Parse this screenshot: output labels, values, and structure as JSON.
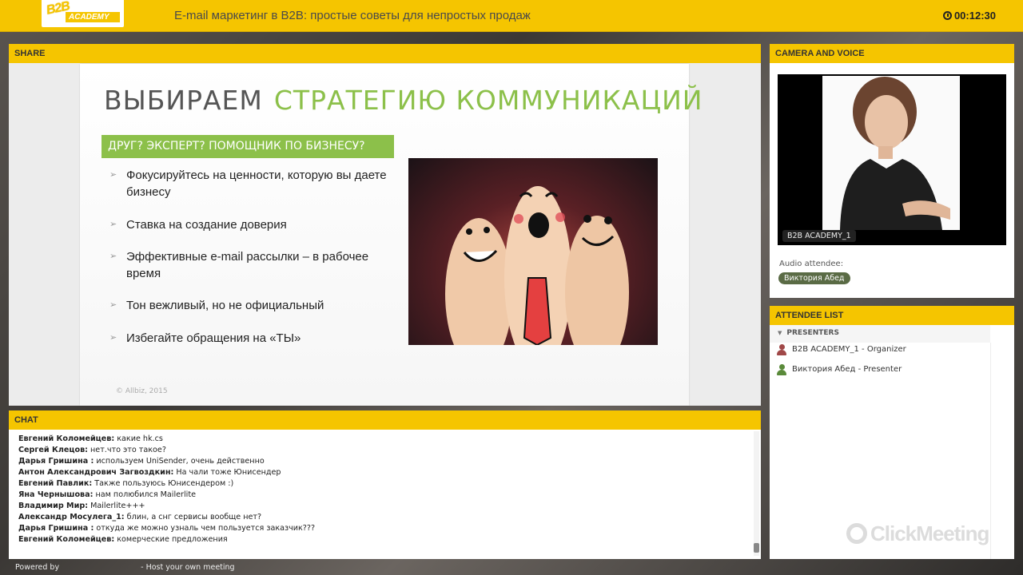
{
  "header": {
    "logo_top": "B2B",
    "logo_bottom": "ACADEMY",
    "title": "E-mail маркетинг в B2B: простые советы для непростых продаж",
    "timer": "00:12:30"
  },
  "share": {
    "label": "SHARE",
    "slide": {
      "title_part1": "ВЫБИРАЕМ",
      "title_part2": "СТРАТЕГИЮ КОММУНИКАЦИЙ",
      "subtitle": "ДРУГ? ЭКСПЕРТ? ПОМОЩНИК ПО БИЗНЕСУ?",
      "bullets": [
        "Фокусируйтесь на  ценности, которую вы даете бизнесу",
        "Ставка на создание доверия",
        "Эффективные e-mail рассылки – в рабочее время",
        "Тон вежливый, но не официальный",
        "Избегайте обращения на «ТЫ»"
      ],
      "footer": "© Allbiz, 2015"
    }
  },
  "chat": {
    "label": "CHAT",
    "messages": [
      {
        "author": "Евгений Коломейцев:",
        "text": " какие hk.cs"
      },
      {
        "author": "Сергей Клецов:",
        "text": " нет.что это такое?"
      },
      {
        "author": "Дарья  Гришина :",
        "text": " используем UniSender, очень действенно"
      },
      {
        "author": "Антон Александрович Загвоздкин:",
        "text": " На чали тоже Юнисендер"
      },
      {
        "author": "Евгений Павлик:",
        "text": " Также пользуюсь Юнисендером :)"
      },
      {
        "author": "Яна Чернышова:",
        "text": " нам полюбился Mailerlite"
      },
      {
        "author": "Владимир Мир:",
        "text": " Mailerlite+++"
      },
      {
        "author": "Александр Мосулега_1:",
        "text": " блин, а снг сервисы вообще нет?"
      },
      {
        "author": "Дарья  Гришина :",
        "text": " откуда же можно узналь чем пользуется заказчик???"
      },
      {
        "author": "Евгений Коломейцев:",
        "text": " комерческие предложения"
      }
    ]
  },
  "camera": {
    "label": "CAMERA AND VOICE",
    "video_label": "B2B ACADEMY_1",
    "audio_label": "Audio attendee:",
    "audio_name": "Виктория Абед"
  },
  "attendees": {
    "label": "ATTENDEE LIST",
    "group": "PRESENTERS",
    "list": [
      {
        "name": "B2B ACADEMY_1 - Organizer",
        "color": "#a04848"
      },
      {
        "name": "Виктория Абед - Presenter",
        "color": "#5a8a3a"
      }
    ],
    "watermark": "ClickMeeting"
  },
  "footer": {
    "powered": "Powered by",
    "host": "- Host your own meeting"
  }
}
